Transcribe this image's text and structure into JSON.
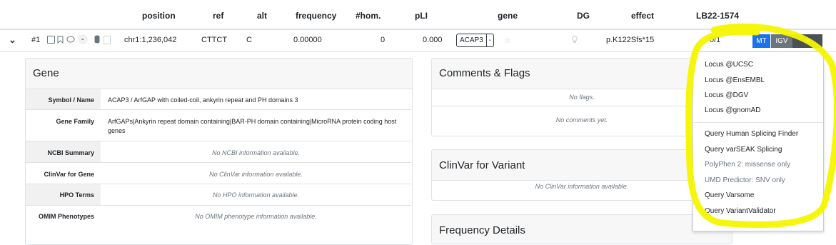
{
  "header": {
    "position": "position",
    "ref": "ref",
    "alt": "alt",
    "frequency": "frequency",
    "hom": "#hom.",
    "pli": "pLI",
    "gene": "gene",
    "dg": "DG",
    "effect": "effect",
    "sample": "LB22-1574"
  },
  "variant": {
    "index": "#1",
    "dash": "-",
    "position": "chr1:1,236,042",
    "ref": "CTTCT",
    "alt": "C",
    "frequency": "0.00000",
    "hom": "0",
    "pli": "0.000",
    "gene": "ACAP3",
    "gene_dropdown": "-",
    "effect": "p.K122Sfs*15",
    "genotype": "0/1",
    "btn_mt": "MT",
    "btn_igv": "IGV"
  },
  "gene_card": {
    "title": "Gene",
    "rows": [
      {
        "key": "Symbol / Name",
        "value": "ACAP3 / ArfGAP with coiled-coil, ankyrin repeat and PH domains 3"
      },
      {
        "key": "Gene Family",
        "value": "ArfGAPs|Ankyrin repeat domain containing|BAR-PH domain containing|MicroRNA protein coding host genes"
      },
      {
        "key": "NCBI Summary",
        "value": "No NCBI information available."
      },
      {
        "key": "ClinVar for Gene",
        "value": "No ClinVar information available."
      },
      {
        "key": "HPO Terms",
        "value": "No HPO information available."
      },
      {
        "key": "OMIM Phenotypes",
        "value": "No OMIM phenotype information available."
      }
    ]
  },
  "comments_card": {
    "title": "Comments & Flags",
    "no_flags": "No flags.",
    "no_comments": "No comments yet."
  },
  "clinvar_card": {
    "title": "ClinVar for Variant",
    "empty": "No ClinVar information available."
  },
  "frequency_card": {
    "title": "Frequency Details"
  },
  "dropdown_menu": {
    "items": [
      "Locus @UCSC",
      "Locus @EnsEMBL",
      "Locus @DGV",
      "Locus @gnomAD",
      "Query Human Splicing Finder",
      "Query varSEAK Splicing",
      "PolyPhen 2: missense only",
      "UMD Predictor: SNV only",
      "Query Varsome",
      "Query VariantValidator"
    ]
  },
  "colors": {
    "accent_blue": "#1a73e8",
    "highlight_yellow": "#f5f500",
    "igv_gray": "#6c757d"
  },
  "icons": [
    "chevron-down-icon",
    "checkbox-icon",
    "bookmark-icon",
    "comment-icon",
    "database-icon",
    "lightbulb-icon",
    "caret-down-icon"
  ]
}
